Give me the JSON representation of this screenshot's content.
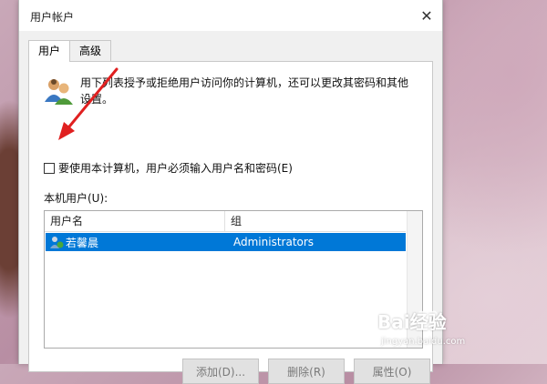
{
  "window": {
    "title": "用户帐户",
    "close_icon": "close-icon"
  },
  "tabs": [
    {
      "label": "用户",
      "active": true
    },
    {
      "label": "高级",
      "active": false
    }
  ],
  "panel": {
    "description": "用下列表授予或拒绝用户访问你的计算机，还可以更改其密码和其他设置。",
    "checkbox": {
      "label": "要使用本计算机，用户必须输入用户名和密码(E)",
      "checked": false
    },
    "users_label": "本机用户(U):",
    "columns": {
      "name": "用户名",
      "group": "组"
    },
    "users": [
      {
        "name": "若馨晨",
        "group": "Administrators",
        "selected": true
      }
    ],
    "buttons": {
      "add": "添加(D)...",
      "remove": "删除(R)",
      "properties": "属性(O)"
    }
  },
  "watermark": {
    "logo_text": "Bai经验",
    "url": "jingyan.baidu.com"
  },
  "colors": {
    "selection": "#0078d7",
    "annotation_arrow": "#e02020"
  }
}
